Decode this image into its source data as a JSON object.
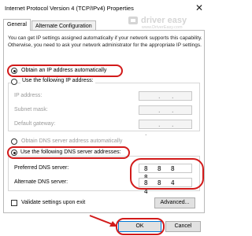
{
  "window": {
    "title": "Internet Protocol Version 4 (TCP/IPv4) Properties",
    "close_glyph": "✕"
  },
  "tabs": [
    {
      "label": "General"
    },
    {
      "label": "Alternate Configuration"
    }
  ],
  "description": "You can get IP settings assigned automatically if your network supports this capability. Otherwise, you need to ask your network administrator for the appropriate IP settings.",
  "ip_section": {
    "auto_label": "Obtain an IP address automatically",
    "manual_label": "Use the following IP address:",
    "fields": [
      {
        "label": "IP address:",
        "value": [
          ".",
          ".",
          "."
        ]
      },
      {
        "label": "Subnet mask:",
        "value": [
          ".",
          ".",
          "."
        ]
      },
      {
        "label": "Default gateway:",
        "value": [
          ".",
          ".",
          "."
        ]
      }
    ]
  },
  "dns_section": {
    "auto_label": "Obtain DNS server address automatically",
    "manual_label": "Use the following DNS server addresses:",
    "preferred_label": "Preferred DNS server:",
    "preferred_octets": [
      "8",
      "8",
      "8",
      "8"
    ],
    "alternate_label": "Alternate DNS server:",
    "alternate_octets": [
      "8",
      "8",
      "4",
      "4"
    ]
  },
  "validate_label": "Validate settings upon exit",
  "buttons": {
    "advanced": "Advanced...",
    "ok": "OK",
    "cancel": "Cancel"
  },
  "watermark": {
    "brand": "driver easy",
    "url": "www.DriverEasy.com"
  },
  "colors": {
    "highlight_red": "#d21a1a",
    "ok_border": "#0078d7"
  }
}
